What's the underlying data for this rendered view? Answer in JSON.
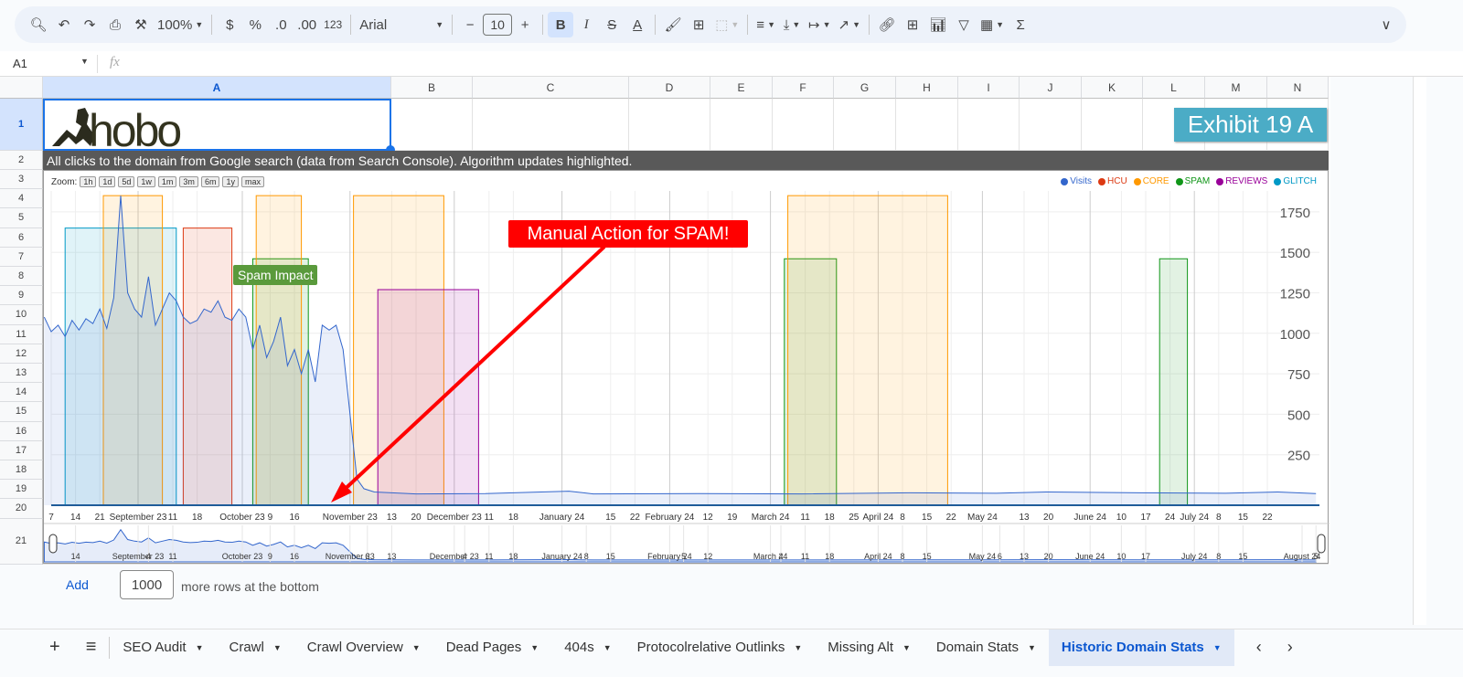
{
  "toolbar": {
    "zoom": "100%",
    "currency": "$",
    "percent": "%",
    "dec_decrease": ".0",
    "dec_increase": ".00",
    "number_format": "123",
    "font": "Arial",
    "font_size": "10",
    "bold": "B",
    "italic": "I",
    "text_color": "A"
  },
  "formula_bar": {
    "cell_ref": "A1",
    "fx": "fx",
    "value": ""
  },
  "columns": [
    "A",
    "B",
    "C",
    "D",
    "E",
    "F",
    "G",
    "H",
    "I",
    "J",
    "K",
    "L",
    "M",
    "N"
  ],
  "rows": [
    "1",
    "2",
    "3",
    "4",
    "5",
    "6",
    "7",
    "8",
    "9",
    "10",
    "11",
    "12",
    "13",
    "14",
    "15",
    "16",
    "17",
    "18",
    "19",
    "20",
    "21"
  ],
  "cells": {
    "logo_text": "hobo",
    "exhibit": "Exhibit 19 A",
    "row2": "All clicks to the domain from Google search (data from Search Console). Algorithm updates highlighted."
  },
  "chart": {
    "zoom_label": "Zoom:",
    "zoom_buttons": [
      "1h",
      "1d",
      "5d",
      "1w",
      "1m",
      "3m",
      "6m",
      "1y",
      "max"
    ],
    "annotations": {
      "spam_impact": "Spam Impact",
      "manual_action": "Manual Action for SPAM!"
    },
    "colors": {
      "Visits": "#3366cc",
      "HCU": "#dc3912",
      "CORE": "#ff9900",
      "SPAM": "#109618",
      "REVIEWS": "#990099",
      "GLITCH": "#0099c6",
      "exhibit_bg": "#4bacc6",
      "annotation_red": "#ff0000",
      "annotation_green": "#5a9a3c"
    }
  },
  "chart_data": {
    "type": "area",
    "legend": [
      "Visits",
      "HCU",
      "CORE",
      "SPAM",
      "REVIEWS",
      "GLITCH"
    ],
    "legend_position": "top-right",
    "yticks": [
      250,
      500,
      750,
      1000,
      1250,
      1500,
      1750
    ],
    "ylim": [
      -62,
      1900
    ],
    "xlim": [
      "2023-08-07",
      "2024-08-07"
    ],
    "xticks": [
      [
        "7",
        "2023-08-07"
      ],
      [
        "14",
        "2023-08-14"
      ],
      [
        "21",
        "2023-08-21"
      ],
      [
        "September 23",
        "2023-09-01"
      ],
      [
        "11",
        "2023-09-11"
      ],
      [
        "18",
        "2023-09-18"
      ],
      [
        "October 23",
        "2023-10-01"
      ],
      [
        "9",
        "2023-10-09"
      ],
      [
        "16",
        "2023-10-16"
      ],
      [
        "November 23",
        "2023-11-01"
      ],
      [
        "13",
        "2023-11-13"
      ],
      [
        "20",
        "2023-11-20"
      ],
      [
        "December 23",
        "2023-12-01"
      ],
      [
        "11",
        "2023-12-11"
      ],
      [
        "18",
        "2023-12-18"
      ],
      [
        "January 24",
        "2024-01-01"
      ],
      [
        "15",
        "2024-01-15"
      ],
      [
        "22",
        "2024-01-22"
      ],
      [
        "February 24",
        "2024-02-01"
      ],
      [
        "12",
        "2024-02-12"
      ],
      [
        "19",
        "2024-02-19"
      ],
      [
        "March 24",
        "2024-03-01"
      ],
      [
        "11",
        "2024-03-11"
      ],
      [
        "18",
        "2024-03-18"
      ],
      [
        "25",
        "2024-03-25"
      ],
      [
        "April 24",
        "2024-04-01"
      ],
      [
        "8",
        "2024-04-08"
      ],
      [
        "15",
        "2024-04-15"
      ],
      [
        "22",
        "2024-04-22"
      ],
      [
        "May 24",
        "2024-05-01"
      ],
      [
        "13",
        "2024-05-13"
      ],
      [
        "20",
        "2024-05-20"
      ],
      [
        "June 24",
        "2024-06-01"
      ],
      [
        "10",
        "2024-06-10"
      ],
      [
        "17",
        "2024-06-17"
      ],
      [
        "24",
        "2024-06-24"
      ],
      [
        "July 24",
        "2024-07-01"
      ],
      [
        "8",
        "2024-07-08"
      ],
      [
        "15",
        "2024-07-15"
      ],
      [
        "22",
        "2024-07-22"
      ]
    ],
    "navigator_ticks": [
      [
        "14",
        "2023-08-14"
      ],
      [
        "September 23",
        "2023-09-01"
      ],
      [
        "4",
        "2023-09-04"
      ],
      [
        "11",
        "2023-09-11"
      ],
      [
        "October 23",
        "2023-10-01"
      ],
      [
        "9",
        "2023-10-09"
      ],
      [
        "16",
        "2023-10-16"
      ],
      [
        "November 23",
        "2023-11-01"
      ],
      [
        "6",
        "2023-11-06"
      ],
      [
        "13",
        "2023-11-13"
      ],
      [
        "December 23",
        "2023-12-01"
      ],
      [
        "4",
        "2023-12-04"
      ],
      [
        "11",
        "2023-12-11"
      ],
      [
        "18",
        "2023-12-18"
      ],
      [
        "January 24",
        "2024-01-01"
      ],
      [
        "8",
        "2024-01-08"
      ],
      [
        "15",
        "2024-01-15"
      ],
      [
        "February 24",
        "2024-02-01"
      ],
      [
        "5",
        "2024-02-05"
      ],
      [
        "12",
        "2024-02-12"
      ],
      [
        "March 24",
        "2024-03-01"
      ],
      [
        "4",
        "2024-03-04"
      ],
      [
        "11",
        "2024-03-11"
      ],
      [
        "18",
        "2024-03-18"
      ],
      [
        "April 24",
        "2024-04-01"
      ],
      [
        "8",
        "2024-04-08"
      ],
      [
        "15",
        "2024-04-15"
      ],
      [
        "May 24",
        "2024-05-01"
      ],
      [
        "6",
        "2024-05-06"
      ],
      [
        "13",
        "2024-05-13"
      ],
      [
        "20",
        "2024-05-20"
      ],
      [
        "June 24",
        "2024-06-01"
      ],
      [
        "10",
        "2024-06-10"
      ],
      [
        "17",
        "2024-06-17"
      ],
      [
        "July 24",
        "2024-07-01"
      ],
      [
        "8",
        "2024-07-08"
      ],
      [
        "15",
        "2024-07-15"
      ],
      [
        "August 24",
        "2024-08-01"
      ],
      [
        "5",
        "2024-08-05"
      ]
    ],
    "bands": [
      {
        "series": "GLITCH",
        "start": "2023-08-11",
        "end": "2023-09-12",
        "value": 1650
      },
      {
        "series": "CORE",
        "start": "2023-08-22",
        "end": "2023-09-08",
        "value": 1850
      },
      {
        "series": "HCU",
        "start": "2023-09-14",
        "end": "2023-09-28",
        "value": 1650
      },
      {
        "series": "SPAM",
        "start": "2023-10-04",
        "end": "2023-10-20",
        "value": 1460
      },
      {
        "series": "CORE",
        "start": "2023-10-05",
        "end": "2023-10-18",
        "value": 1850
      },
      {
        "series": "CORE",
        "start": "2023-11-02",
        "end": "2023-11-28",
        "value": 1850
      },
      {
        "series": "REVIEWS",
        "start": "2023-11-09",
        "end": "2023-12-08",
        "value": 1270
      },
      {
        "series": "SPAM",
        "start": "2024-03-05",
        "end": "2024-03-20",
        "value": 1460
      },
      {
        "series": "CORE",
        "start": "2024-03-06",
        "end": "2024-04-21",
        "value": 1850
      },
      {
        "series": "SPAM",
        "start": "2024-06-21",
        "end": "2024-06-29",
        "value": 1460
      }
    ],
    "visits": [
      [
        "2023-08-05",
        1100
      ],
      [
        "2023-08-07",
        1010
      ],
      [
        "2023-08-09",
        1050
      ],
      [
        "2023-08-11",
        980
      ],
      [
        "2023-08-13",
        1080
      ],
      [
        "2023-08-15",
        1020
      ],
      [
        "2023-08-17",
        1090
      ],
      [
        "2023-08-19",
        1060
      ],
      [
        "2023-08-21",
        1150
      ],
      [
        "2023-08-23",
        1030
      ],
      [
        "2023-08-25",
        1220
      ],
      [
        "2023-08-27",
        1850
      ],
      [
        "2023-08-29",
        1250
      ],
      [
        "2023-08-31",
        1150
      ],
      [
        "2023-09-02",
        1100
      ],
      [
        "2023-09-04",
        1350
      ],
      [
        "2023-09-06",
        1050
      ],
      [
        "2023-09-08",
        1150
      ],
      [
        "2023-09-10",
        1250
      ],
      [
        "2023-09-12",
        1200
      ],
      [
        "2023-09-14",
        1100
      ],
      [
        "2023-09-16",
        1060
      ],
      [
        "2023-09-18",
        1080
      ],
      [
        "2023-09-20",
        1150
      ],
      [
        "2023-09-22",
        1130
      ],
      [
        "2023-09-24",
        1200
      ],
      [
        "2023-09-26",
        1100
      ],
      [
        "2023-09-28",
        1080
      ],
      [
        "2023-09-30",
        1150
      ],
      [
        "2023-10-02",
        1100
      ],
      [
        "2023-10-04",
        900
      ],
      [
        "2023-10-06",
        1050
      ],
      [
        "2023-10-08",
        850
      ],
      [
        "2023-10-10",
        950
      ],
      [
        "2023-10-12",
        1100
      ],
      [
        "2023-10-14",
        800
      ],
      [
        "2023-10-16",
        900
      ],
      [
        "2023-10-18",
        750
      ],
      [
        "2023-10-20",
        900
      ],
      [
        "2023-10-22",
        700
      ],
      [
        "2023-10-24",
        1050
      ],
      [
        "2023-10-26",
        1020
      ],
      [
        "2023-10-28",
        1050
      ],
      [
        "2023-10-30",
        900
      ],
      [
        "2023-11-01",
        500
      ],
      [
        "2023-11-03",
        100
      ],
      [
        "2023-11-05",
        40
      ],
      [
        "2023-11-08",
        20
      ],
      [
        "2023-11-20",
        8
      ],
      [
        "2023-12-10",
        10
      ],
      [
        "2024-01-03",
        25
      ],
      [
        "2024-01-10",
        8
      ],
      [
        "2024-02-10",
        10
      ],
      [
        "2024-03-10",
        8
      ],
      [
        "2024-04-10",
        15
      ],
      [
        "2024-05-05",
        12
      ],
      [
        "2024-05-20",
        20
      ],
      [
        "2024-06-15",
        15
      ],
      [
        "2024-07-10",
        12
      ],
      [
        "2024-07-25",
        20
      ],
      [
        "2024-08-05",
        10
      ]
    ]
  },
  "add_rows": {
    "button": "Add",
    "count": "1000",
    "suffix": "more rows at the bottom"
  },
  "sheet_tabs": [
    "SEO Audit",
    "Crawl",
    "Crawl Overview",
    "Dead Pages",
    "404s",
    "Protocolrelative Outlinks",
    "Missing Alt",
    "Domain Stats",
    "Historic Domain Stats"
  ],
  "active_tab": "Historic Domain Stats"
}
